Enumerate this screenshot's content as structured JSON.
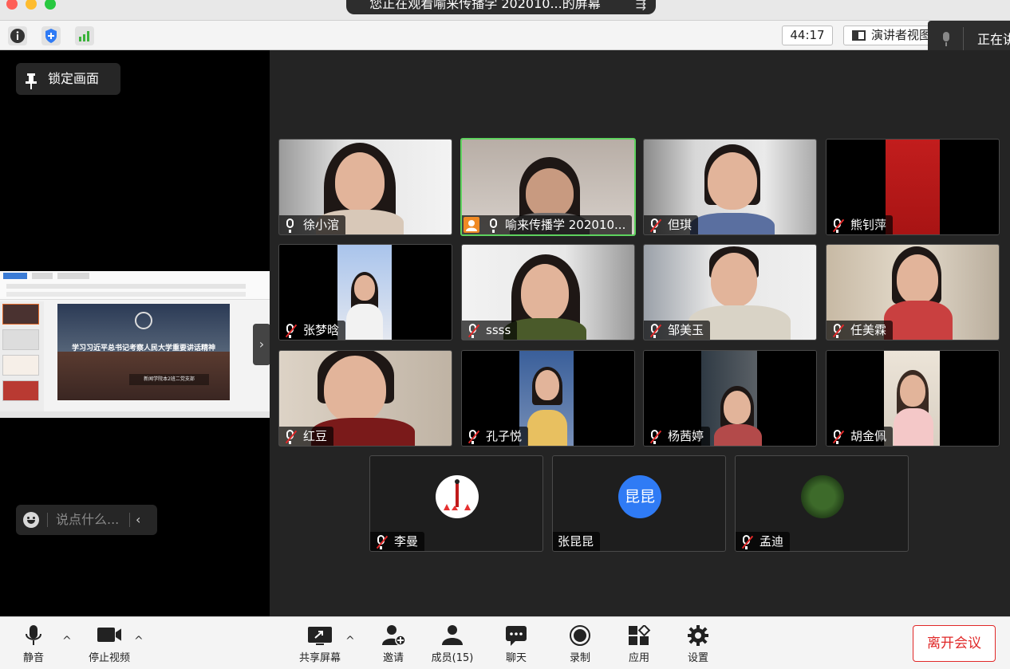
{
  "window": {
    "share_banner": "您正在观看喻来传播学 202010...的屏幕",
    "timer": "44:17",
    "view_mode": "演讲者视图",
    "speaking_label": "正在讲"
  },
  "left_panel": {
    "lock_label": "锁定画面",
    "chat_placeholder": "说点什么...",
    "shared_slide_title": "学习习近平总书记考察人民大学重要讲话精神",
    "shared_slide_subtitle": "新闻学院本2班二党支部"
  },
  "participants": [
    {
      "name": "徐小涫",
      "muted": false
    },
    {
      "name": "喻来传播学 202010...",
      "muted": false,
      "host": true,
      "active_speaker": true
    },
    {
      "name": "但琪",
      "muted": true
    },
    {
      "name": "熊钊萍",
      "muted": true
    },
    {
      "name": "张梦晗",
      "muted": true
    },
    {
      "name": "ssss",
      "muted": true
    },
    {
      "name": "邹美玉",
      "muted": true
    },
    {
      "name": "任美霖",
      "muted": true
    },
    {
      "name": "红豆",
      "muted": true
    },
    {
      "name": "孔子悦",
      "muted": true
    },
    {
      "name": "杨茜婷",
      "muted": true
    },
    {
      "name": "胡金佩",
      "muted": true
    },
    {
      "name": "李曼",
      "muted": true,
      "avatar": "image"
    },
    {
      "name": "张昆昆",
      "muted": false,
      "no_mic": true,
      "avatar_text": "昆昆",
      "avatar_color": "#2f7bf5"
    },
    {
      "name": "孟迪",
      "muted": true,
      "avatar": "image"
    }
  ],
  "toolbar": {
    "mute": "静音",
    "stop_video": "停止视频",
    "share_screen": "共享屏幕",
    "invite": "邀请",
    "members": "成员(15)",
    "chat": "聊天",
    "record": "录制",
    "apps": "应用",
    "settings": "设置",
    "leave": "离开会议"
  },
  "colors": {
    "active_speaker_border": "#5ed25e",
    "leave_red": "#e02828",
    "host_badge": "#f08a24"
  }
}
